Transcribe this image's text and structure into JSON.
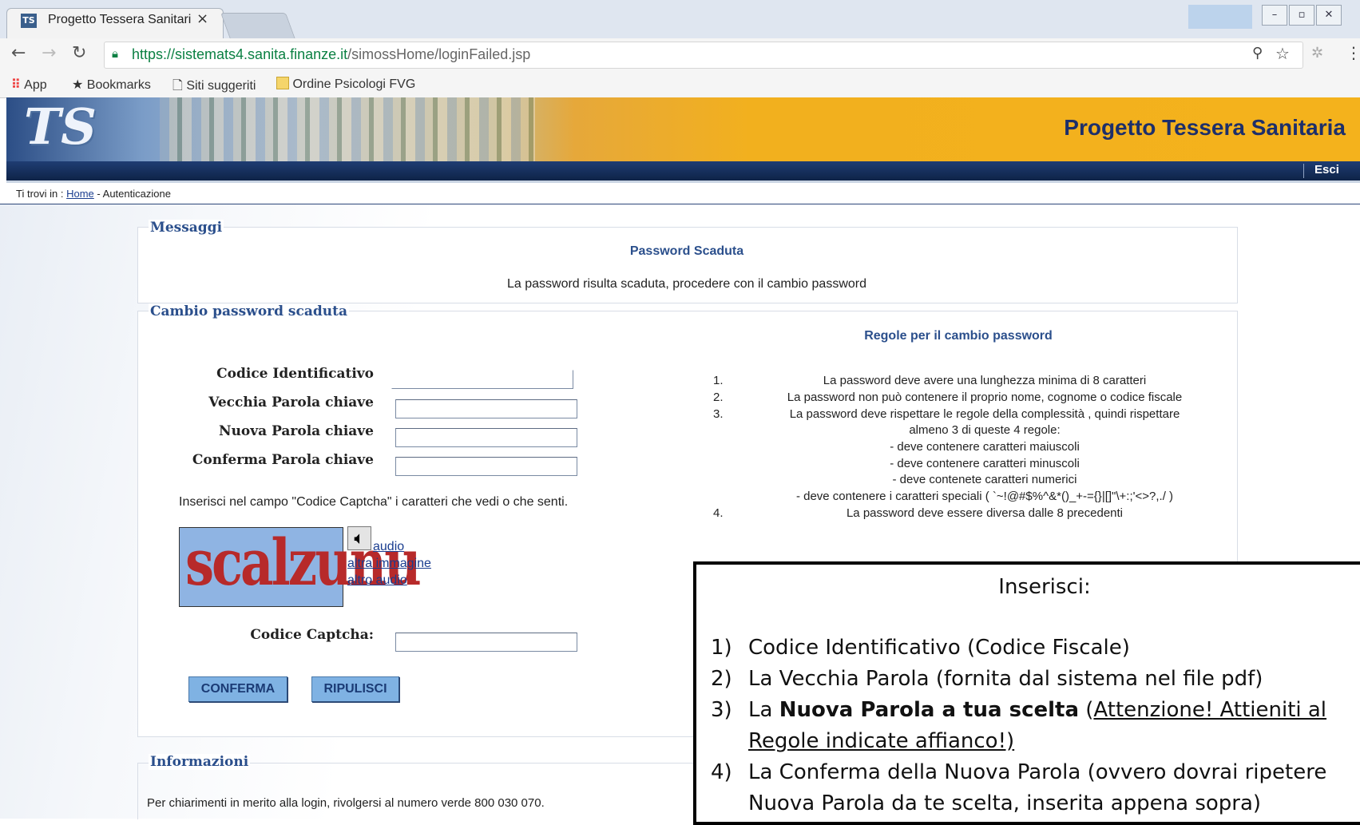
{
  "browser": {
    "tab_title": "Progetto Tessera Sanitari",
    "tab_favicon": "TS",
    "tab_close": "×",
    "url_host": "https://sistemats4.sanita.finanze.it",
    "url_path": "/simossHome/loginFailed.jsp",
    "bookmarks": [
      {
        "label": "App",
        "icon": "apps-grid-icon"
      },
      {
        "label": "Bookmarks",
        "icon": "star-icon"
      },
      {
        "label": "Siti suggeriti",
        "icon": "page-icon"
      },
      {
        "label": "Ordine Psicologi FVG",
        "icon": "folder-icon"
      }
    ],
    "window_controls": [
      "–",
      "▫",
      "✕"
    ]
  },
  "site": {
    "logo": "TS",
    "title": "Progetto Tessera Sanitaria",
    "logout": "Esci",
    "breadcrumb_prefix": "Ti trovi in :",
    "breadcrumb_home": "Home",
    "breadcrumb_current": "- Autenticazione"
  },
  "messages": {
    "section_title": "Messaggi",
    "heading": "Password Scaduta",
    "text": "La password risulta scaduta, procedere con il cambio password"
  },
  "change_password": {
    "section_title": "Cambio password scaduta",
    "fields": [
      {
        "label": "Codice Identificativo",
        "value": ""
      },
      {
        "label": "Vecchia Parola chiave",
        "value": ""
      },
      {
        "label": "Nuova Parola chiave",
        "value": ""
      },
      {
        "label": "Conferma Parola chiave",
        "value": ""
      }
    ],
    "captcha_instructions": "Inserisci nel campo \"Codice Captcha\" i caratteri che vedi o che senti.",
    "captcha_image_text": "scalzunu",
    "captcha_links": {
      "audio": "audio",
      "new_image": "altra immagine",
      "new_audio": "altro audio"
    },
    "captcha_label": "Codice Captcha:",
    "captcha_value": "",
    "confirm_button": "CONFERMA",
    "reset_button": "RIPULISCI"
  },
  "rules": {
    "title": "Regole per il cambio password",
    "items": [
      {
        "num": "1.",
        "text": "La password deve avere una lunghezza minima di 8 caratteri"
      },
      {
        "num": "2.",
        "text": "La password non può contenere il proprio nome, cognome o codice fiscale"
      },
      {
        "num": "3.",
        "text": "La password deve rispettare le regole della complessità , quindi rispettare"
      },
      {
        "num": "",
        "text": "almeno 3 di queste 4 regole:"
      },
      {
        "num": "",
        "text": "- deve contenere caratteri maiuscoli"
      },
      {
        "num": "",
        "text": "- deve contenere caratteri minuscoli"
      },
      {
        "num": "",
        "text": "- deve contenete caratteri numerici"
      },
      {
        "num": "",
        "text": "- deve contenere i caratteri speciali ( `~!@#$%^&*()_+-={}|[]\"\\+:;'<>?,./ )"
      },
      {
        "num": "4.",
        "text": "La password deve essere diversa dalle 8 precedenti"
      }
    ]
  },
  "info": {
    "section_title": "Informazioni",
    "text": "Per chiarimenti in merito alla login, rivolgersi al numero verde 800 030 070."
  },
  "overlay": {
    "heading": "Inserisci:",
    "items": [
      {
        "num": "1)",
        "text": "Codice Identificativo (Codice Fiscale)"
      },
      {
        "num": "2)",
        "text": "La Vecchia Parola (fornita dal sistema nel file pdf)"
      },
      {
        "num": "3)",
        "pre": "La ",
        "bold": "Nuova Parola a tua scelta",
        "mid": " (",
        "underlined": "Attenzione! Attieniti al",
        "underlined2": "Regole indicate affianco!)"
      },
      {
        "num": "4)",
        "text": "La Conferma della Nuova Parola (ovvero dovrai ripetere",
        "text2": "Nuova Parola da te scelta, inserita appena sopra)"
      }
    ]
  }
}
